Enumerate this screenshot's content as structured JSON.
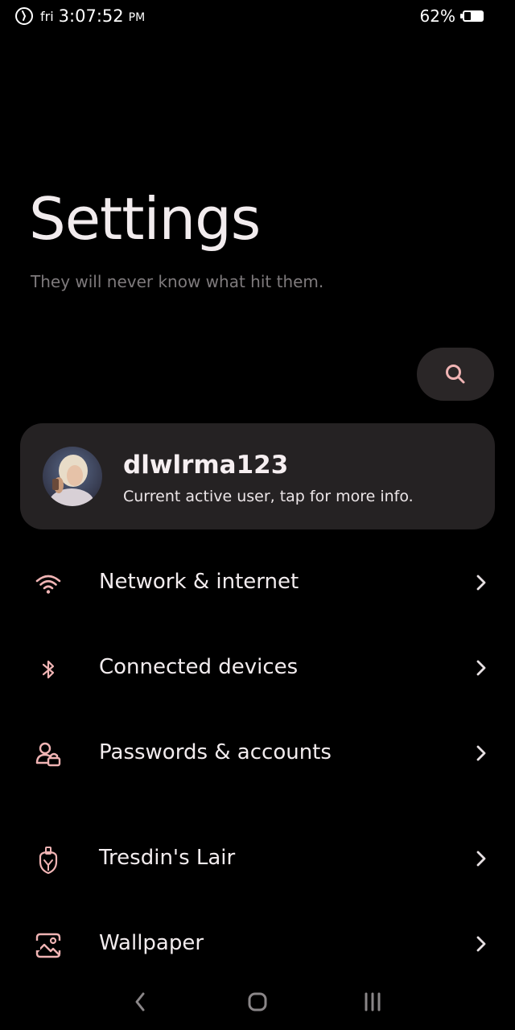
{
  "status_bar": {
    "day": "fri",
    "time": "3:07:52",
    "ampm": "PM",
    "battery": "62%",
    "icons": [
      "timer-icon",
      "battery-icon"
    ]
  },
  "header": {
    "title": "Settings",
    "subtitle": "They will never know what hit them."
  },
  "search": {
    "icon": "search-icon"
  },
  "user": {
    "name": "dlwlrma123",
    "subtitle": "Current active user, tap for more info."
  },
  "items": [
    {
      "label": "Network & internet",
      "icon": "wifi-icon"
    },
    {
      "label": "Connected devices",
      "icon": "bluetooth-icon"
    },
    {
      "label": "Passwords & accounts",
      "icon": "account-icon"
    },
    {
      "label": "Tresdin's Lair",
      "icon": "shield-icon"
    },
    {
      "label": "Wallpaper",
      "icon": "wallpaper-icon"
    }
  ],
  "nav": {
    "icons": [
      "back-icon",
      "home-icon",
      "recents-icon"
    ]
  },
  "colors": {
    "accent": "#f0b4b4",
    "background": "#000000",
    "card": "#252223",
    "search_bg": "#2a2627",
    "subtitle": "#7e7a7c"
  }
}
